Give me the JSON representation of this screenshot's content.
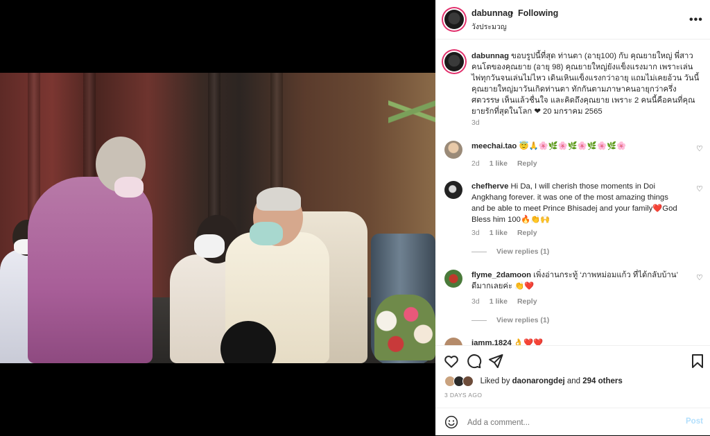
{
  "post": {
    "username": "dabunnag",
    "separator": "•",
    "follow_status": "Following",
    "location": "วังประมวญ",
    "more_label": "•••"
  },
  "caption": {
    "username": "dabunnag",
    "text": "ขอบรูปนี้ที่สุด ท่านตา (อายุ100) กับ คุณยายใหญ่ พี่สาวคนโตของคุณยาย (อายุ 98) คุณยายใหญ่ยังแข็งแรงมาก เพราะเล่นไพ่ทุกวันจนเล่นไม่ไหว เดินเหินแข็งแรงกว่าอายุ แถมไม่เคยอ้วน วันนี้ คุณยายใหญ่มาวันเกิดท่านตา ทักกันตามภาษาคนอายุกว่าครึ่งศตวรรษ เห็นแล้วชื่นใจ และคิดถึงคุณยาย เพราะ 2 คนนี้คือคนที่คุณยายรักที่สุดในโลก ❤ 20 มกราคม 2565",
    "time": "3d"
  },
  "comments": [
    {
      "username": "meechai.tao",
      "text": "😇🙏🌸🌿🌸🌿🌸🌿🌸🌿🌸",
      "time": "2d",
      "likes": "1 like",
      "reply_label": "Reply"
    },
    {
      "username": "chefherve",
      "text": "Hi Da, I will cherish those moments in Doi Angkhang forever. it was one of the most amazing things and be able to meet Prince Bhisadej and your family❤️God Bless him 100🔥👏🙌",
      "time": "3d",
      "likes": "1 like",
      "reply_label": "Reply",
      "view_replies": "View replies (1)"
    },
    {
      "username": "flyme_2damoon",
      "text": "เพิ่งอ่านกระทู้ ‘ภาพหม่อมแก้ว ที่ได้กลับบ้าน’ ดีมากเลยค่ะ 👏❤️",
      "time": "3d",
      "likes": "1 like",
      "reply_label": "Reply",
      "view_replies": "View replies (1)"
    },
    {
      "username": "iamm.1824",
      "text": "👌❤️❤️"
    }
  ],
  "likes_section": {
    "prefix": "Liked by ",
    "liker": "daonarongdej",
    "middle": " and ",
    "others": "294 others"
  },
  "date_label": "3 DAYS AGO",
  "comment_box": {
    "placeholder": "Add a comment...",
    "post_label": "Post"
  },
  "icons": {
    "like": "heart-icon",
    "comment": "comment-icon",
    "share": "paper-plane-icon",
    "save": "bookmark-icon",
    "emoji": "smiley-icon",
    "more": "ellipsis-icon"
  },
  "colors": {
    "story_ring": "#e1306c",
    "post_button_disabled": "#b2dffc",
    "muted": "#8e8e8e",
    "text": "#262626"
  }
}
